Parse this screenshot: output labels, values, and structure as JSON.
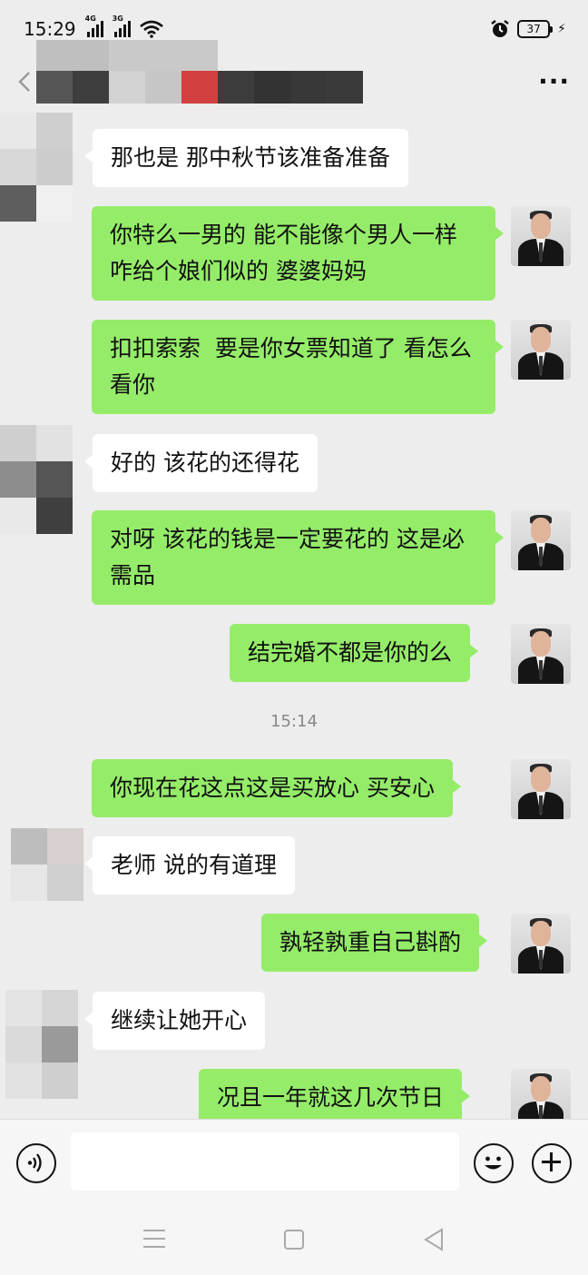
{
  "status_bar": {
    "time": "15:29",
    "signal1_label": "4G",
    "signal2_label": "3G",
    "battery": "37",
    "charging_icon": "bolt-icon"
  },
  "header": {
    "back_icon": "chevron-left-icon",
    "more_label": "···"
  },
  "messages": [
    {
      "side": "other",
      "text": "那也是 那中秋节该准备准备"
    },
    {
      "side": "me",
      "text": "你特么一男的 能不能像个男人一样 咋给个娘们似的 婆婆妈妈"
    },
    {
      "side": "me",
      "text": "扣扣索索  要是你女票知道了 看怎么看你"
    },
    {
      "side": "other",
      "text": "好的 该花的还得花"
    },
    {
      "side": "me",
      "text": "对呀 该花的钱是一定要花的 这是必需品"
    },
    {
      "side": "me",
      "text": "结完婚不都是你的么"
    },
    {
      "side": "me",
      "text": "你现在花这点这是买放心 买安心"
    },
    {
      "side": "other",
      "text": "老师 说的有道理"
    },
    {
      "side": "me",
      "text": "孰轻孰重自己斟酌"
    },
    {
      "side": "other",
      "text": "继续让她开心"
    },
    {
      "side": "me",
      "text": "况且一年就这几次节日"
    }
  ],
  "timestamp": "15:14",
  "input": {
    "value": "",
    "placeholder": ""
  },
  "colors": {
    "my_bubble": "#95ec69",
    "other_bubble": "#ffffff",
    "background": "#ededed"
  }
}
